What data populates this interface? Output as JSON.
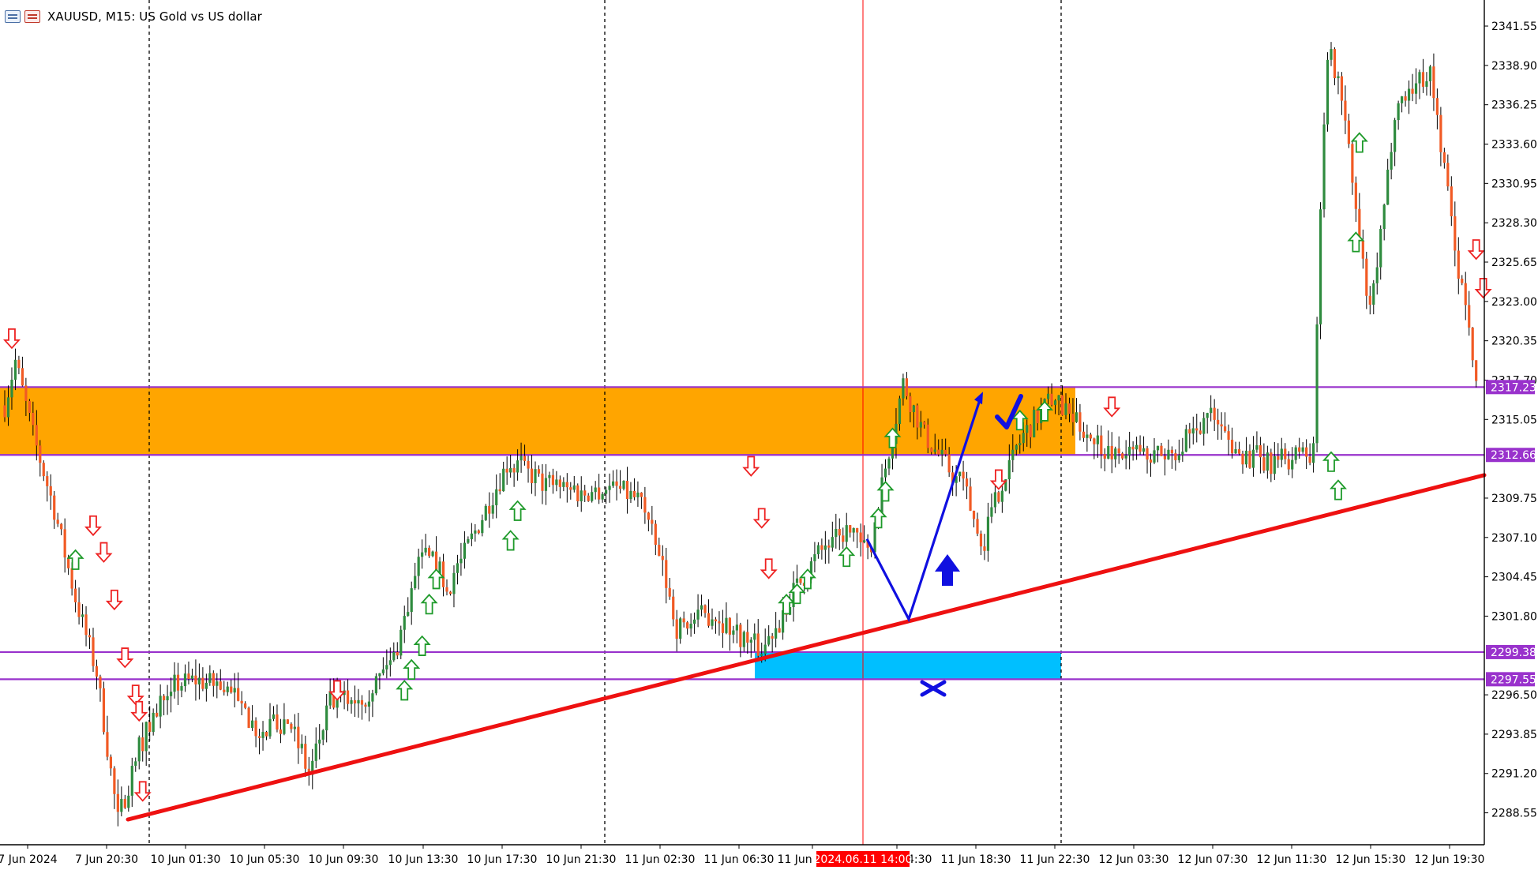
{
  "window": {
    "title": "XAUUSD, M15:  US Gold vs US dollar",
    "icons": [
      "chart-window-icon",
      "chart-tab-icon"
    ]
  },
  "colors": {
    "bull": "#2e8b3e",
    "bear": "#f15a24",
    "zone_supply": "#ffa500",
    "zone_demand": "#00bfff",
    "level_line": "#9932cc",
    "trendline": "#ee1111",
    "annotation": "#1010e0",
    "time_marker": "#ff0000"
  },
  "price_axis": {
    "ticks": [
      "2341.55",
      "2338.90",
      "2336.25",
      "2333.60",
      "2330.95",
      "2328.30",
      "2325.65",
      "2323.00",
      "2320.35",
      "2317.70",
      "2315.05",
      "2309.75",
      "2307.10",
      "2304.45",
      "2301.80",
      "2296.50",
      "2293.85",
      "2291.20",
      "2288.55"
    ],
    "level_labels": [
      "2317.23",
      "2312.66",
      "2299.38",
      "2297.55"
    ]
  },
  "time_axis": {
    "labels": [
      "7 Jun 2024",
      "7 Jun 20:30",
      "10 Jun 01:30",
      "10 Jun 05:30",
      "10 Jun 09:30",
      "10 Jun 13:30",
      "10 Jun 17:30",
      "10 Jun 21:30",
      "11 Jun 02:30",
      "11 Jun 06:30",
      "11 Jun 10:30",
      "11 Jun 14:30",
      "11 Jun 18:30",
      "11 Jun 22:30",
      "12 Jun 03:30",
      "12 Jun 07:30",
      "12 Jun 11:30",
      "12 Jun 15:30",
      "12 Jun 19:30"
    ],
    "marker_label": "2024.06.11 14:00"
  },
  "annotations": {
    "supply_zone": {
      "top": 2317.23,
      "bottom": 2312.66
    },
    "demand_zone": {
      "top": 2299.38,
      "bottom": 2297.55
    },
    "horizontal_levels": [
      2317.23,
      2312.66,
      2299.38,
      2297.55
    ],
    "trendline": {
      "from_price": 2288.1,
      "to_price": 2311.3
    },
    "path_prices": [
      2307.0,
      2301.6,
      2316.7
    ],
    "check_icon": "checkmark-icon",
    "cross_icon": "cross-icon",
    "up_arrow_icon": "up-arrow-icon"
  },
  "chart_data": {
    "type": "candlestick",
    "symbol": "XAUUSD",
    "timeframe": "M15",
    "price_range": [
      2286.4,
      2343.2
    ],
    "anchors": [
      {
        "t": 0,
        "p": 2316.0
      },
      {
        "t": 3,
        "p": 2319.0
      },
      {
        "t": 8,
        "p": 2314.0
      },
      {
        "t": 14,
        "p": 2309.0
      },
      {
        "t": 20,
        "p": 2303.0
      },
      {
        "t": 26,
        "p": 2298.0
      },
      {
        "t": 32,
        "p": 2288.0
      },
      {
        "t": 38,
        "p": 2293.0
      },
      {
        "t": 46,
        "p": 2297.0
      },
      {
        "t": 54,
        "p": 2297.5
      },
      {
        "t": 62,
        "p": 2297.0
      },
      {
        "t": 72,
        "p": 2294.0
      },
      {
        "t": 80,
        "p": 2295.0
      },
      {
        "t": 86,
        "p": 2291.0
      },
      {
        "t": 92,
        "p": 2296.0
      },
      {
        "t": 102,
        "p": 2296.5
      },
      {
        "t": 110,
        "p": 2299.0
      },
      {
        "t": 118,
        "p": 2306.0
      },
      {
        "t": 126,
        "p": 2304.0
      },
      {
        "t": 134,
        "p": 2308.0
      },
      {
        "t": 142,
        "p": 2312.0
      },
      {
        "t": 152,
        "p": 2311.0
      },
      {
        "t": 162,
        "p": 2310.0
      },
      {
        "t": 172,
        "p": 2310.5
      },
      {
        "t": 180,
        "p": 2309.5
      },
      {
        "t": 186,
        "p": 2305.0
      },
      {
        "t": 190,
        "p": 2301.0
      },
      {
        "t": 200,
        "p": 2302.0
      },
      {
        "t": 208,
        "p": 2300.5
      },
      {
        "t": 214,
        "p": 2299.5
      },
      {
        "t": 222,
        "p": 2303.0
      },
      {
        "t": 230,
        "p": 2306.0
      },
      {
        "t": 238,
        "p": 2307.5
      },
      {
        "t": 244,
        "p": 2306.0
      },
      {
        "t": 250,
        "p": 2313.0
      },
      {
        "t": 254,
        "p": 2317.5
      },
      {
        "t": 260,
        "p": 2314.0
      },
      {
        "t": 266,
        "p": 2312.0
      },
      {
        "t": 272,
        "p": 2310.0
      },
      {
        "t": 276,
        "p": 2306.5
      },
      {
        "t": 282,
        "p": 2311.0
      },
      {
        "t": 288,
        "p": 2314.0
      },
      {
        "t": 296,
        "p": 2316.5
      },
      {
        "t": 302,
        "p": 2315.0
      },
      {
        "t": 312,
        "p": 2313.0
      },
      {
        "t": 322,
        "p": 2312.5
      },
      {
        "t": 332,
        "p": 2313.0
      },
      {
        "t": 340,
        "p": 2315.5
      },
      {
        "t": 348,
        "p": 2313.0
      },
      {
        "t": 356,
        "p": 2312.0
      },
      {
        "t": 364,
        "p": 2312.5
      },
      {
        "t": 370,
        "p": 2312.8
      },
      {
        "t": 372,
        "p": 2330.0
      },
      {
        "t": 374,
        "p": 2340.0
      },
      {
        "t": 378,
        "p": 2337.0
      },
      {
        "t": 383,
        "p": 2327.0
      },
      {
        "t": 386,
        "p": 2322.0
      },
      {
        "t": 390,
        "p": 2329.0
      },
      {
        "t": 393,
        "p": 2336.0
      },
      {
        "t": 398,
        "p": 2337.5
      },
      {
        "t": 403,
        "p": 2338.5
      },
      {
        "t": 407,
        "p": 2332.0
      },
      {
        "t": 411,
        "p": 2325.0
      },
      {
        "t": 414,
        "p": 2322.0
      },
      {
        "t": 416,
        "p": 2317.5
      }
    ],
    "signals": {
      "buy": [
        [
          20,
          2305.6
        ],
        [
          113,
          2296.8
        ],
        [
          115,
          2298.2
        ],
        [
          118,
          2299.8
        ],
        [
          120,
          2302.6
        ],
        [
          122,
          2304.3
        ],
        [
          143,
          2306.9
        ],
        [
          145,
          2308.9
        ],
        [
          221,
          2302.6
        ],
        [
          224,
          2303.3
        ],
        [
          227,
          2304.3
        ],
        [
          238,
          2305.8
        ],
        [
          247,
          2308.4
        ],
        [
          249,
          2310.2
        ],
        [
          251,
          2313.8
        ],
        [
          287,
          2315.0
        ],
        [
          294,
          2315.6
        ],
        [
          375,
          2312.2
        ],
        [
          377,
          2310.3
        ],
        [
          382,
          2327.0
        ],
        [
          383,
          2333.7
        ]
      ],
      "sell": [
        [
          2,
          2320.5
        ],
        [
          25,
          2307.9
        ],
        [
          28,
          2306.1
        ],
        [
          31,
          2302.9
        ],
        [
          34,
          2299.0
        ],
        [
          37,
          2296.5
        ],
        [
          38,
          2295.4
        ],
        [
          39,
          2290.0
        ],
        [
          94,
          2296.8
        ],
        [
          211,
          2311.9
        ],
        [
          214,
          2308.4
        ],
        [
          216,
          2305.0
        ],
        [
          281,
          2311.0
        ],
        [
          313,
          2315.9
        ],
        [
          416,
          2326.5
        ],
        [
          418,
          2323.9
        ]
      ]
    }
  }
}
